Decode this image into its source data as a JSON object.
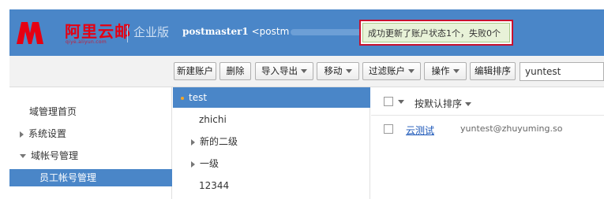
{
  "brand": {
    "name": "阿里云邮",
    "subtitle": "qiye.aliyun.com",
    "edition": "企业版",
    "accent_color": "#e60012",
    "header_color": "#4a86c8"
  },
  "user": {
    "name": "postmaster1",
    "email_prefix": "<postm",
    "email_suffix": ">"
  },
  "toast": {
    "message": "成功更新了账户状态1个，失败0个"
  },
  "toolbar": {
    "new_account": "新建账户",
    "delete": "删除",
    "import_export": "导入导出",
    "move": "移动",
    "filter_account": "过滤账户",
    "operations": "操作",
    "edit_sort": "编辑排序",
    "search_value": "yuntest"
  },
  "nav": {
    "items": [
      {
        "label": "域管理首页"
      },
      {
        "label": "系统设置",
        "icon": "triangle-right-icon"
      },
      {
        "label": "域帐号管理",
        "icon": "triangle-down-icon"
      },
      {
        "label": "员工帐号管理"
      }
    ]
  },
  "tree": {
    "items": [
      {
        "label": "test"
      },
      {
        "label": "zhichi"
      },
      {
        "label": "新的二级",
        "icon": "triangle-right-icon"
      },
      {
        "label": "一级",
        "icon": "triangle-right-icon"
      },
      {
        "label": "12344"
      }
    ]
  },
  "list": {
    "sort_label": "按默认排序",
    "rows": [
      {
        "name": "云测试",
        "email": "yuntest@zhuyuming.so"
      }
    ]
  }
}
